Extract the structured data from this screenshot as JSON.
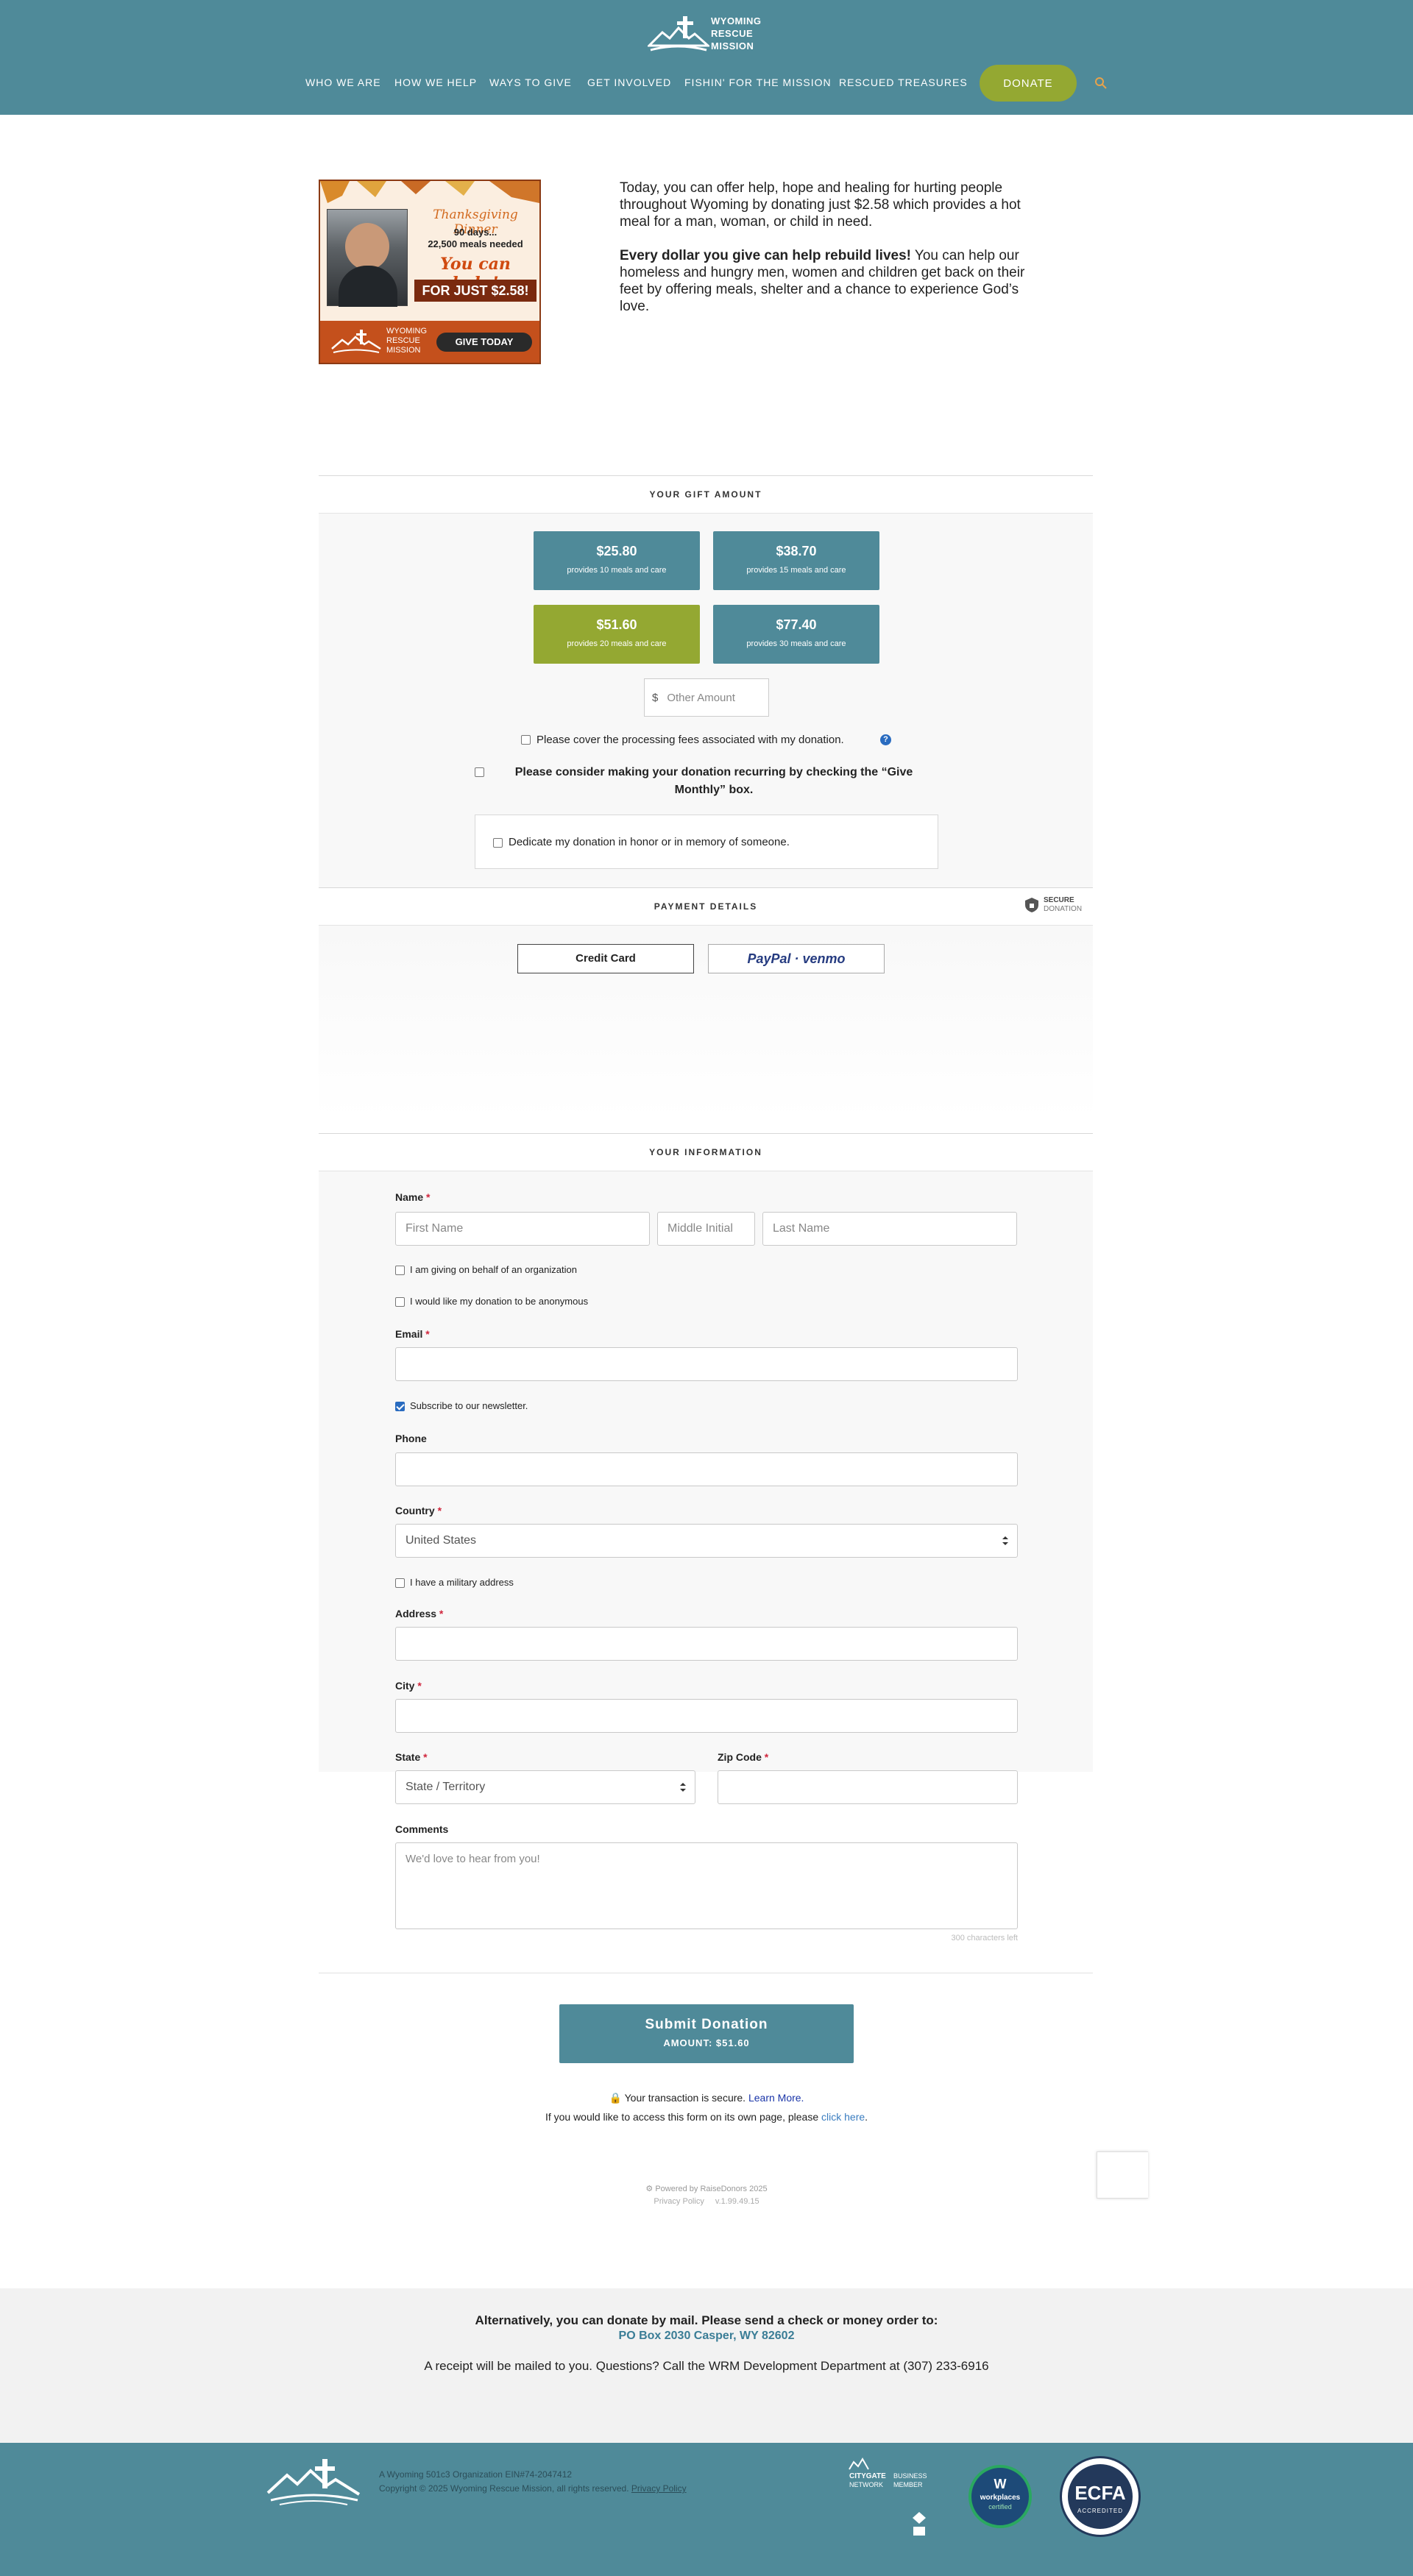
{
  "header": {
    "logo_lines": [
      "WYOMING",
      "RESCUE",
      "MISSION"
    ],
    "nav": [
      "WHO WE ARE",
      "HOW WE HELP",
      "WAYS TO GIVE",
      "GET INVOLVED",
      "FISHIN' FOR THE MISSION",
      "RESCUED TREASURES"
    ],
    "donate_label": "DONATE",
    "search_icon": "search-icon",
    "colors": {
      "header_bg": "#4f8a99",
      "accent_green": "#94a832"
    }
  },
  "promo": {
    "title": "Thanksgiving Dinner",
    "line1": "90 days...",
    "line2": "22,500 meals needed",
    "help": "You can help!",
    "price": "FOR JUST $2.58!",
    "logo_lines": [
      "WYOMING",
      "RESCUE",
      "MISSION"
    ],
    "cta": "GIVE TODAY"
  },
  "intro": {
    "p1": "Today, you can offer help, hope and healing for hurting people throughout Wyoming by donating just $2.58 which provides a hot meal for a man, woman, or child in need.",
    "p2_bold": "Every dollar you give can help rebuild lives!",
    "p2_rest": " You can help our homeless and hungry men, women and children get back on their feet by offering meals, shelter and a chance to experience God’s love."
  },
  "gift": {
    "heading": "YOUR GIFT AMOUNT",
    "amounts": [
      {
        "value": "$25.80",
        "desc": "provides 10 meals and care",
        "selected": false
      },
      {
        "value": "$38.70",
        "desc": "provides 15 meals and care",
        "selected": false
      },
      {
        "value": "$51.60",
        "desc": "provides 20 meals and care",
        "selected": true
      },
      {
        "value": "$77.40",
        "desc": "provides 30 meals and care",
        "selected": false
      }
    ],
    "currency_symbol": "$",
    "other_placeholder": "Other Amount",
    "cover_fees_label": "Please cover the processing fees associated with my donation.",
    "help_icon": "?",
    "recurring_label": "Please consider making your donation recurring by checking the “Give Monthly” box.",
    "dedicate_label": "Dedicate my donation in honor or in memory of someone."
  },
  "payment": {
    "heading": "PAYMENT DETAILS",
    "secure_badge": [
      "SECURE",
      "DONATION"
    ],
    "tabs": [
      "Credit Card",
      "PayPal · venmo"
    ],
    "active_tab": "Credit Card"
  },
  "info": {
    "heading": "YOUR INFORMATION",
    "name_label": "Name",
    "first_placeholder": "First Name",
    "middle_placeholder": "Middle Initial",
    "last_placeholder": "Last Name",
    "org_label": "I am giving on behalf of an organization",
    "anon_label": "I would like my donation to be anonymous",
    "email_label": "Email",
    "newsletter_label": "Subscribe to our newsletter.",
    "phone_label": "Phone",
    "country_label": "Country",
    "country_value": "United States",
    "military_label": "I have a military address",
    "address_label": "Address",
    "city_label": "City",
    "state_label": "State",
    "state_placeholder": "State / Territory",
    "zip_label": "Zip Code",
    "comments_label": "Comments",
    "comments_placeholder": "We'd love to hear from you!",
    "char_count": "300 characters left",
    "required_mark": "*"
  },
  "submit": {
    "label": "Submit Donation",
    "amount": "AMOUNT: $51.60"
  },
  "footer_notes": {
    "secure_text": "Your transaction is secure.",
    "learn_more": "Learn More.",
    "standalone_text": "If you would like to access this form on its own page, please",
    "click_here": "click here",
    "period": ".",
    "powered": "Powered by RaiseDonors 2025",
    "privacy": "Privacy Policy",
    "version": "v.1.99.49.15"
  },
  "mail": {
    "title": "Alternatively, you can donate by mail. Please send a check or money order to:",
    "address": "PO Box 2030 Casper, WY 82602",
    "receipt": "A receipt will be mailed to you. Questions? Call the WRM Development Department at (307) 233-6916"
  },
  "footer": {
    "line1": "A Wyoming 501c3 Organization EIN#74-2047412",
    "line2_prefix": "Copyright © 2025 Wyoming Rescue Mission, all rights reserved.",
    "privacy_link": "Privacy Policy",
    "citygate": [
      "CITYGATE",
      "NETWORK",
      "BUSINESS",
      "MEMBER"
    ],
    "workplaces": [
      "workplaces",
      "certified"
    ],
    "ecfa": [
      "ECFA",
      "ACCREDITED"
    ]
  }
}
